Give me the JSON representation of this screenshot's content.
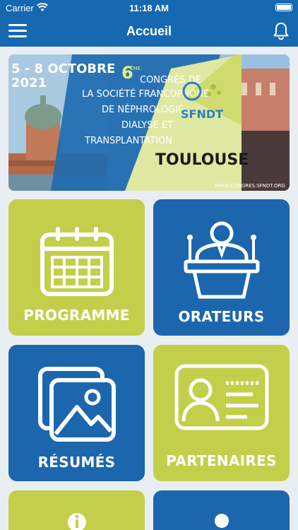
{
  "status_bar": {
    "carrier": "Carrier",
    "time": "11:18 AM"
  },
  "nav": {
    "title": "Accueil"
  },
  "banner": {
    "dates": "5 - 8 OCTOBRE",
    "year": "2021",
    "edition_num": "6",
    "edition_sup": "ÈME",
    "title_lines": [
      "CONGRÈS DE",
      "LA SOCIÉTÉ FRANCOPHONE",
      "DE NÉPHROLOGIE,",
      "DIALYSE ET",
      "TRANSPLANTATION"
    ],
    "logo_text": "SFNDT",
    "city": "TOULOUSE",
    "url": "WWW.CONGRES.SFNDT.ORG"
  },
  "tiles": [
    {
      "label": "PROGRAMME",
      "icon": "calendar-icon",
      "color": "#c3cf4a"
    },
    {
      "label": "ORATEURS",
      "icon": "speaker-podium-icon",
      "color": "#1c66ae"
    },
    {
      "label": "RÉSUMÉS",
      "icon": "image-gallery-icon",
      "color": "#1c66ae"
    },
    {
      "label": "PARTENAIRES",
      "icon": "id-card-icon",
      "color": "#c3cf4a"
    }
  ]
}
